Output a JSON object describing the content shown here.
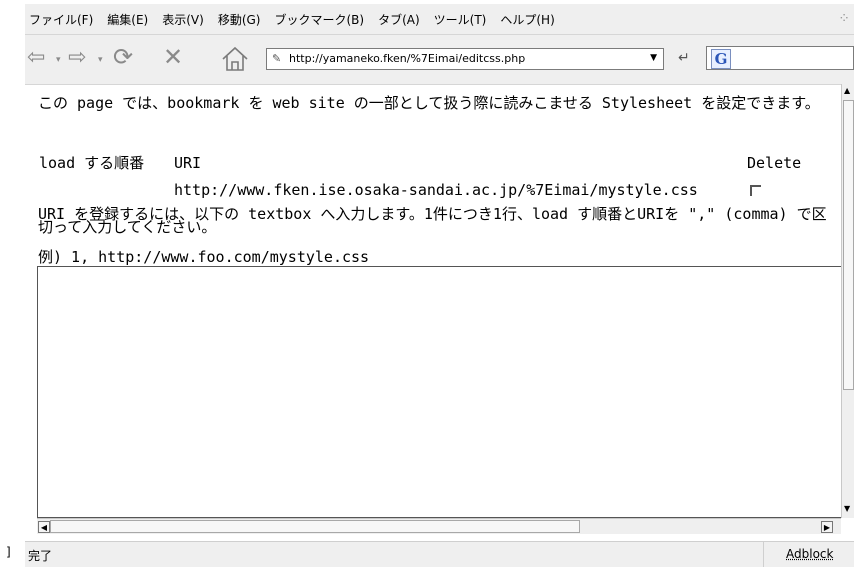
{
  "menubar": {
    "items": [
      {
        "label": "ファイル(F)"
      },
      {
        "label": "編集(E)"
      },
      {
        "label": "表示(V)"
      },
      {
        "label": "移動(G)"
      },
      {
        "label": "ブックマーク(B)"
      },
      {
        "label": "タブ(A)"
      },
      {
        "label": "ツール(T)"
      },
      {
        "label": "ヘルプ(H)"
      }
    ]
  },
  "toolbar": {
    "url": "http://yamaneko.fken/%7Eimai/editcss.php"
  },
  "content": {
    "intro": "この page では、bookmark を web site の一部として扱う際に読みこませる Stylesheet を設定できます。",
    "headers": {
      "order": "load する順番",
      "uri": "URI",
      "delete": "Delete"
    },
    "rows": [
      {
        "uri": "http://www.fken.ise.osaka-sandai.ac.jp/%7Eimai/mystyle.css",
        "delete_checked": false
      }
    ],
    "instructions": "URI を登録するには、以下の textbox へ入力します。1件につき1行、load す順番とURIを \",\" (comma) で区切って入力してください。",
    "example": "例) 1, http://www.foo.com/mystyle.css"
  },
  "statusbar": {
    "status": "完了",
    "adblock": "Adblock"
  },
  "left_mark": "]",
  "icons": {
    "back": "back-arrow-icon",
    "forward": "forward-arrow-icon",
    "reload": "reload-icon",
    "stop": "stop-icon",
    "home": "home-icon",
    "google": "google-icon"
  }
}
